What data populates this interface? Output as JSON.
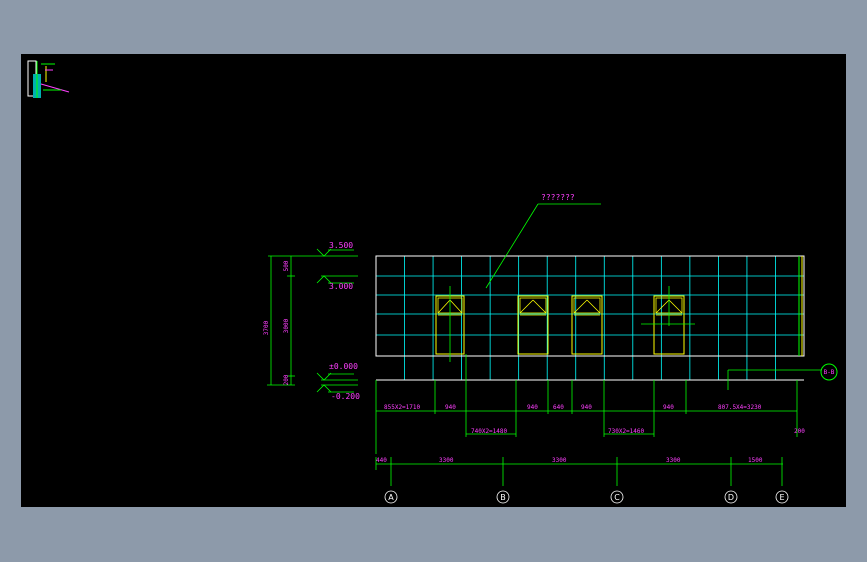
{
  "elevation": {
    "callout_text": "???????",
    "section_tag": "B-B",
    "levels": {
      "top": "3.500",
      "window_head": "3.000",
      "ground": "±0.000",
      "base": "-0.200"
    },
    "vertical_dims": {
      "total": "3700",
      "upper": "500",
      "middle": "3000",
      "lower": "200"
    },
    "opening_dims_row1": [
      "855X2=1710",
      "940",
      "940",
      "640",
      "940",
      "940",
      "807.5X4=3230"
    ],
    "opening_dims_row2": [
      "740X2=1480",
      "730X2=1460",
      "200"
    ],
    "axis_spacing_dims": [
      "440",
      "3300",
      "3300",
      "3300",
      "1500"
    ],
    "axes": [
      "A",
      "B",
      "C",
      "D",
      "E"
    ]
  },
  "colors": {
    "background_ui": "#8d9aaa",
    "canvas": "#000000",
    "dimension_lines": "#00ff00",
    "dimension_text": "#ff40ff",
    "grid_lines": "#00ffff",
    "outline": "#ffffff",
    "window_frames": "#ffff00"
  }
}
